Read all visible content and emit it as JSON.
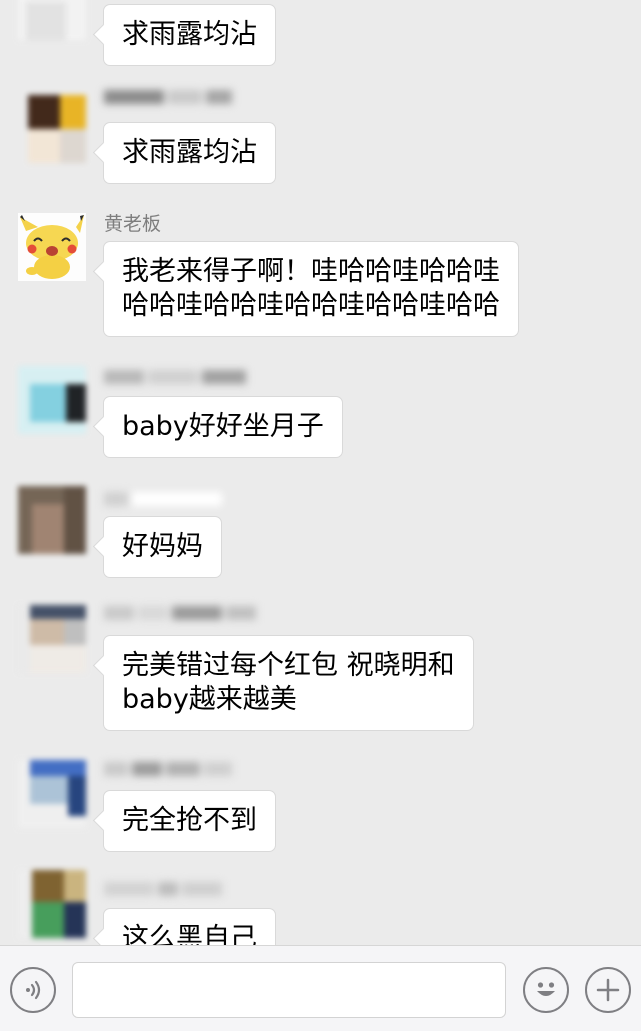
{
  "messages": [
    {
      "text": "求雨露均沾"
    },
    {
      "text": "求雨露均沾"
    },
    {
      "sender": "黄老板",
      "text": "我老来得子啊！哇哈哈哇哈哈哇\n哈哈哇哈哈哇哈哈哇哈哈哇哈哈"
    },
    {
      "text": "baby好好坐月子"
    },
    {
      "text": "好妈妈"
    },
    {
      "text": "完美错过每个红包 祝晓明和\nbaby越来越美"
    },
    {
      "text": "完全抢不到"
    },
    {
      "text": "这么黑自己"
    }
  ],
  "input_bar": {
    "voice_icon": "voice-icon",
    "emoji_icon": "emoji-icon",
    "plus_icon": "plus-icon",
    "input_value": ""
  },
  "colors": {
    "background": "#ebebeb",
    "bubble": "#ffffff",
    "sender_name": "#7e7e7e",
    "bar": "#f5f5f7"
  }
}
